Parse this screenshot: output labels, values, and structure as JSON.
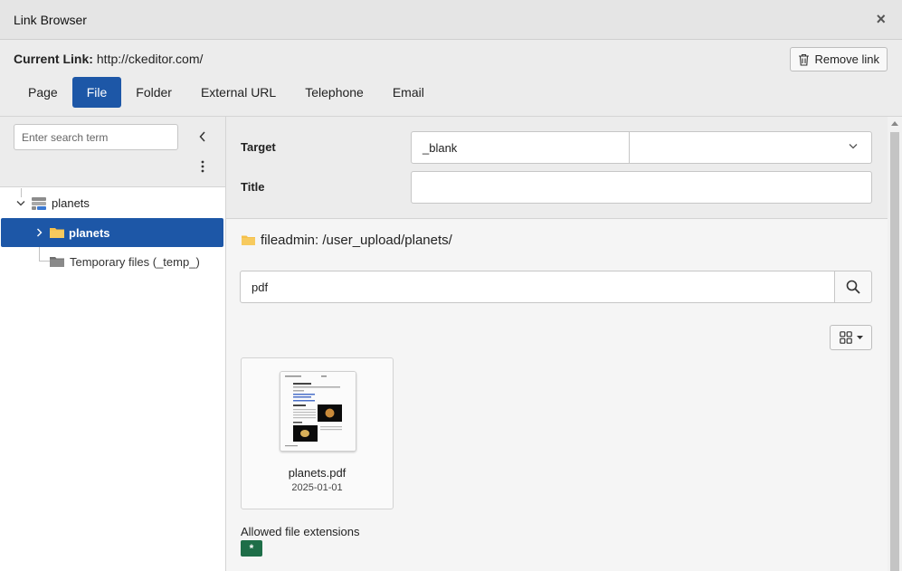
{
  "window": {
    "title": "Link Browser",
    "close_symbol": "×"
  },
  "header": {
    "current_link_label": "Current Link:",
    "current_link_value": "http://ckeditor.com/",
    "remove_link_label": "Remove link"
  },
  "tabs": [
    {
      "label": "Page",
      "active": false
    },
    {
      "label": "File",
      "active": true
    },
    {
      "label": "Folder",
      "active": false
    },
    {
      "label": "External URL",
      "active": false
    },
    {
      "label": "Telephone",
      "active": false
    },
    {
      "label": "Email",
      "active": false
    }
  ],
  "sidebar": {
    "search_placeholder": "Enter search term",
    "tree": [
      {
        "label": "planets",
        "icon": "storage-icon",
        "expanded": true
      },
      {
        "label": "planets",
        "icon": "folder-icon",
        "selected": true
      },
      {
        "label": "Temporary files (_temp_)",
        "icon": "folder-gray-icon"
      }
    ]
  },
  "form": {
    "target_label": "Target",
    "target_value": "_blank",
    "target_select_value": "",
    "title_label": "Title",
    "title_value": ""
  },
  "browser": {
    "path": "fileadmin: /user_upload/planets/",
    "search_value": "pdf",
    "files": [
      {
        "name": "planets.pdf",
        "date": "2025-01-01"
      }
    ],
    "allowed_label": "Allowed file extensions",
    "allowed_extensions": [
      "*"
    ]
  },
  "colors": {
    "accent": "#1d57a7",
    "badge": "#1e6e48",
    "folder": "#f5c04a"
  }
}
